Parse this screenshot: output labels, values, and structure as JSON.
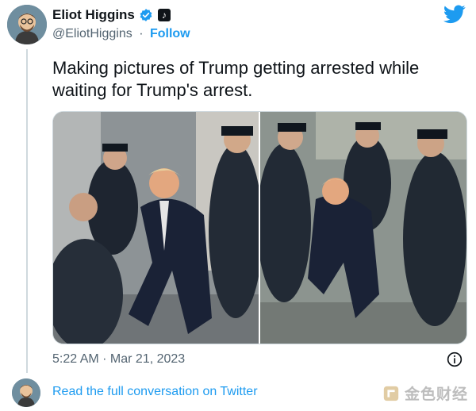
{
  "author": {
    "name": "Eliot Higgins",
    "handle": "@EliotHiggins",
    "separator": "·",
    "follow_label": "Follow"
  },
  "icons": {
    "verified": "verified-badge-icon",
    "extra_badge": "tiktok-icon",
    "brand": "twitter-bird-icon",
    "info": "info-icon"
  },
  "tweet": {
    "text": "Making pictures of Trump getting arrested while waiting for Trump's arrest.",
    "timestamp": "5:22 AM · Mar 21, 2023"
  },
  "footer": {
    "read_more": "Read the full conversation on Twitter"
  },
  "watermark": {
    "text": "金色财经"
  },
  "colors": {
    "accent": "#1d9bf0",
    "text": "#0f1419",
    "secondary": "#536471"
  }
}
